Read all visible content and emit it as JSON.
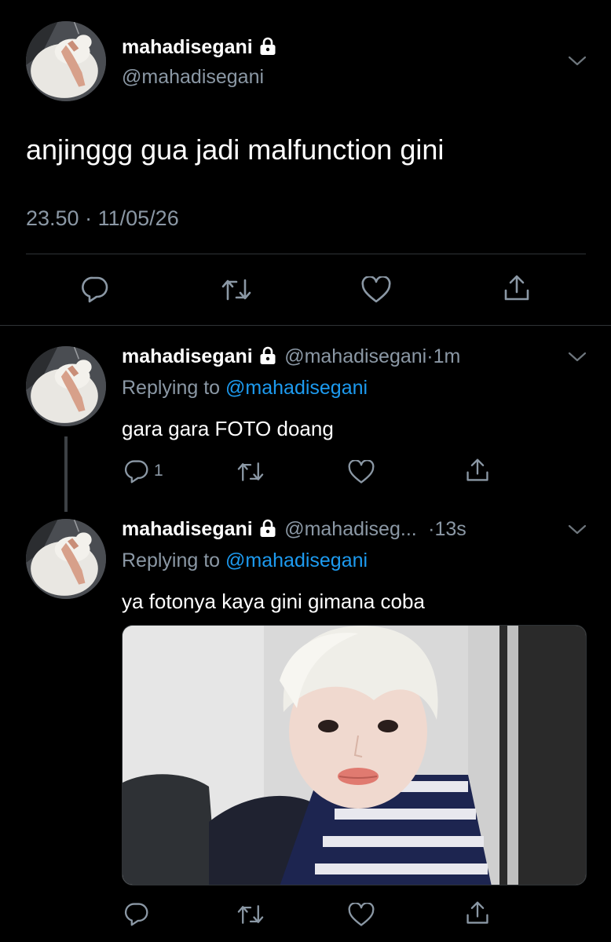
{
  "main_tweet": {
    "display_name": "mahadisegani",
    "handle": "@mahadisegani",
    "text": "anjinggg gua jadi malfunction gini",
    "time": "23.50",
    "separator": "·",
    "date": "11/05/26",
    "icons": [
      "reply-icon",
      "retweet-icon",
      "like-icon",
      "share-icon"
    ]
  },
  "replies": [
    {
      "display_name": "mahadisegani",
      "handle": "@mahadisegani",
      "dot": "·",
      "time_ago": "1m",
      "replying_label": "Replying to",
      "replying_to": "@mahadisegani",
      "text": "gara gara FOTO doang",
      "reply_count": "1"
    },
    {
      "display_name": "mahadisegani",
      "handle": "@mahadiseg...",
      "dot": "·",
      "time_ago": "13s",
      "replying_label": "Replying to",
      "replying_to": "@mahadisegani",
      "text": "ya fotonya kaya gini gimana coba",
      "media": "photo"
    }
  ],
  "colors": {
    "background": "#000000",
    "muted": "#8b98a5",
    "link": "#1d9bf0",
    "divider": "#2f3336"
  }
}
